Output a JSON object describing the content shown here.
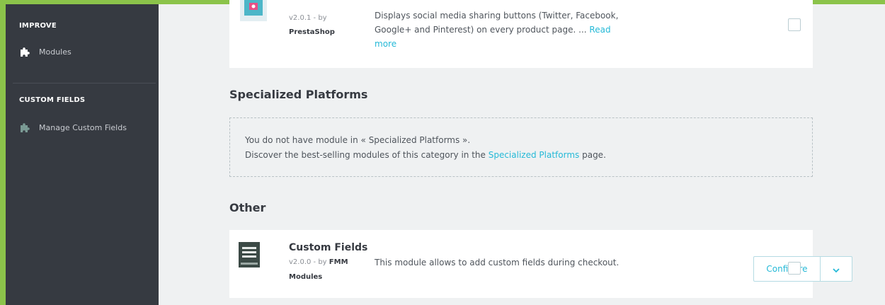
{
  "sidebar": {
    "improve_heading": "IMPROVE",
    "modules_label": "Modules",
    "custom_fields_heading": "CUSTOM FIELDS",
    "manage_custom_fields_label": "Manage Custom Fields"
  },
  "social_module": {
    "version": "v2.0.1 - by",
    "author": "PrestaShop",
    "desc_line1": "Displays social media sharing buttons (Twitter, Facebook,",
    "desc_line2": "Google+ and Pinterest) on every product page. ...",
    "read": "Read",
    "more": "more"
  },
  "specialized": {
    "title": "Specialized Platforms",
    "line1": "You do not have module in « Specialized Platforms ».",
    "line2_prefix": "Discover the best-selling modules of this category in the",
    "line2_link": "Specialized Platforms",
    "line2_suffix": "page."
  },
  "other": {
    "title": "Other",
    "module_name": "Custom Fields",
    "version_prefix": "v2.0.0 - by",
    "author_part1": "FMM",
    "author_part2": "Modules",
    "description": "This module allows to add custom fields during checkout.",
    "configure_label": "Configure"
  },
  "colors": {
    "accent": "#25b9d7",
    "sidebar": "#363a41",
    "frame": "#8bc34a"
  },
  "icons": {
    "modules": "puzzle-icon",
    "manage_custom_fields": "puzzle-icon",
    "dropdown": "chevron-down-icon"
  }
}
